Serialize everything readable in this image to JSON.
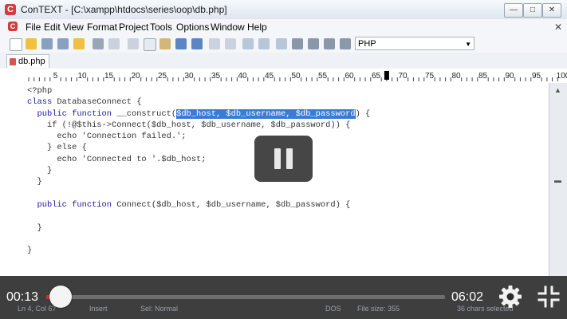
{
  "window": {
    "title": "ConTEXT - [C:\\xampp\\htdocs\\series\\oop\\db.php]",
    "app_icon": "C"
  },
  "window_buttons": {
    "minimize": "—",
    "maximize": "□",
    "close": "✕"
  },
  "menu": [
    "File",
    "Edit",
    "View",
    "Format",
    "Project",
    "Tools",
    "Options",
    "Window",
    "Help"
  ],
  "document_close": "✕",
  "toolbar": {
    "language": "PHP"
  },
  "tab": {
    "label": "db.php"
  },
  "ruler": {
    "labels": [
      "5",
      "10",
      "15",
      "20",
      "25",
      "30",
      "35",
      "40",
      "45",
      "50",
      "55",
      "60",
      "65",
      "70",
      "75",
      "80",
      "85",
      "90",
      "95",
      "100"
    ]
  },
  "code": {
    "l1": "<?php",
    "l2_kw": "class",
    "l2_rest": " DatabaseConnect {",
    "l3_kw": "public function",
    "l3_rest": " __construct(",
    "l3_sel": "$db_host, $db_username, $db_password",
    "l3_end": ") {",
    "l4": "if (!@$this->Connect($db_host, $db_username, $db_password)) {",
    "l5": "echo 'Connection failed.';",
    "l6": "} else {",
    "l7": "echo 'Connected to '.$db_host;",
    "l8": "}",
    "l9": "}",
    "l10_kw": "public function",
    "l10_rest": " Connect($db_host, $db_username, $db_password) {",
    "l11": "}",
    "l12": "}"
  },
  "player": {
    "current_time": "00:13",
    "duration": "06:02",
    "progress": 0.036
  },
  "status": {
    "position": "Ln 4, Col 67",
    "mode": "Insert",
    "sel": "Sel: Normal",
    "format": "DOS",
    "file_size": "File size: 355",
    "selected": "36 chars selected"
  },
  "icons": [
    "app-icon",
    "pause-icon",
    "settings-gear-icon",
    "fullscreen-exit-icon"
  ]
}
